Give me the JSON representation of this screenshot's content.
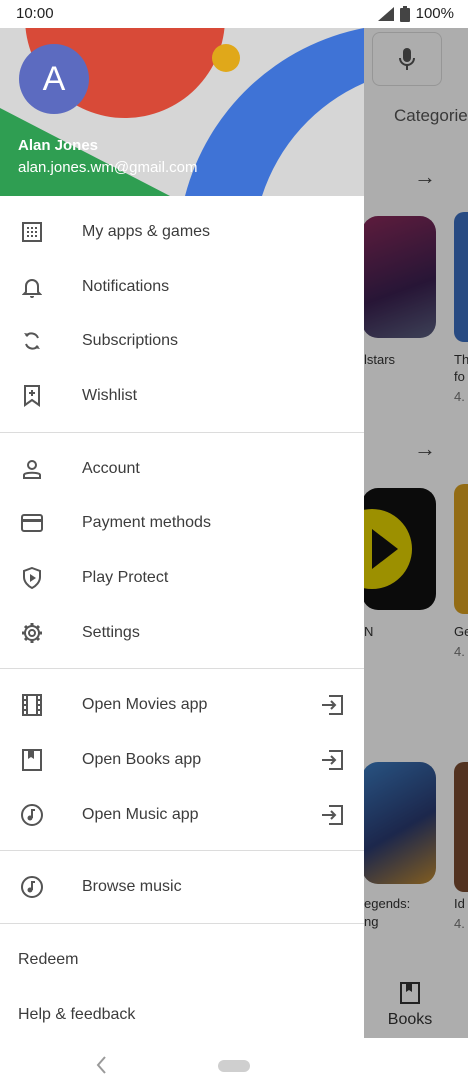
{
  "status_bar": {
    "time": "10:00",
    "battery": "100%"
  },
  "background": {
    "categories_label": "Categorie",
    "row1_labels": [
      "lstars",
      "Th",
      "fo",
      "4."
    ],
    "row2_labels": [
      "N",
      "Ge",
      "4."
    ],
    "row3_labels": [
      "egends:",
      "ng",
      "Id",
      "4."
    ],
    "books_label": "Books"
  },
  "drawer": {
    "avatar_letter": "A",
    "user_name": "Alan Jones",
    "user_email": "alan.jones.wm@gmail.com",
    "group1": [
      {
        "label": "My apps & games",
        "icon": "apps-grid-icon"
      },
      {
        "label": "Notifications",
        "icon": "bell-icon"
      },
      {
        "label": "Subscriptions",
        "icon": "refresh-icon"
      },
      {
        "label": "Wishlist",
        "icon": "bookmark-add-icon"
      }
    ],
    "group2": [
      {
        "label": "Account",
        "icon": "person-icon"
      },
      {
        "label": "Payment methods",
        "icon": "credit-card-icon"
      },
      {
        "label": "Play Protect",
        "icon": "shield-play-icon"
      },
      {
        "label": "Settings",
        "icon": "gear-icon"
      }
    ],
    "group3": [
      {
        "label": "Open Movies app",
        "icon": "film-icon"
      },
      {
        "label": "Open Books app",
        "icon": "book-icon"
      },
      {
        "label": "Open Music app",
        "icon": "music-note-icon"
      }
    ],
    "group4": [
      {
        "label": "Browse music",
        "icon": "music-note-icon"
      }
    ],
    "footer": {
      "redeem": "Redeem",
      "help": "Help & feedback"
    }
  },
  "colors": {
    "accent_red": "#d84a38",
    "accent_blue": "#3f73d6",
    "accent_green": "#2f9e52",
    "accent_yellow": "#e0a81a",
    "avatar": "#5c6bc0"
  }
}
